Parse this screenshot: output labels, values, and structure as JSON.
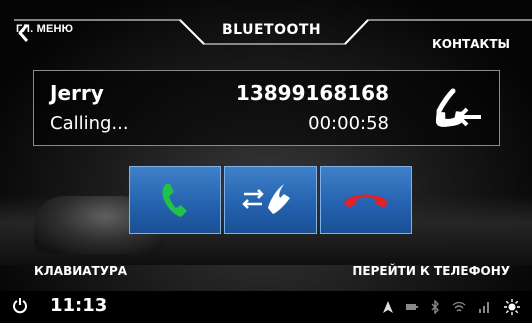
{
  "header": {
    "back_label": "ГЛ. МЕНЮ",
    "title": "BLUETOOTH",
    "contacts_label": "КОНТАКТЫ"
  },
  "call": {
    "name": "Jerry",
    "status": "Calling...",
    "number": "13899168168",
    "timer": "00:00:58",
    "icon": "outgoing-call-icon"
  },
  "actions": {
    "answer_icon": "phone-green-icon",
    "transfer_icon": "transfer-to-phone-icon",
    "hangup_icon": "phone-red-icon",
    "colors": {
      "answer": "#22c24a",
      "hangup": "#e0222a",
      "button": "#2b6bb8"
    }
  },
  "footer": {
    "keypad_label": "КЛАВИАТУРА",
    "goto_phone_label": "ПЕРЕЙТИ К ТЕЛЕФОНУ"
  },
  "statusbar": {
    "time": "11:13",
    "icons": [
      "power-icon",
      "navigation-icon",
      "battery-icon",
      "bluetooth-icon",
      "wifi-icon",
      "signal-icon",
      "brightness-icon"
    ]
  }
}
